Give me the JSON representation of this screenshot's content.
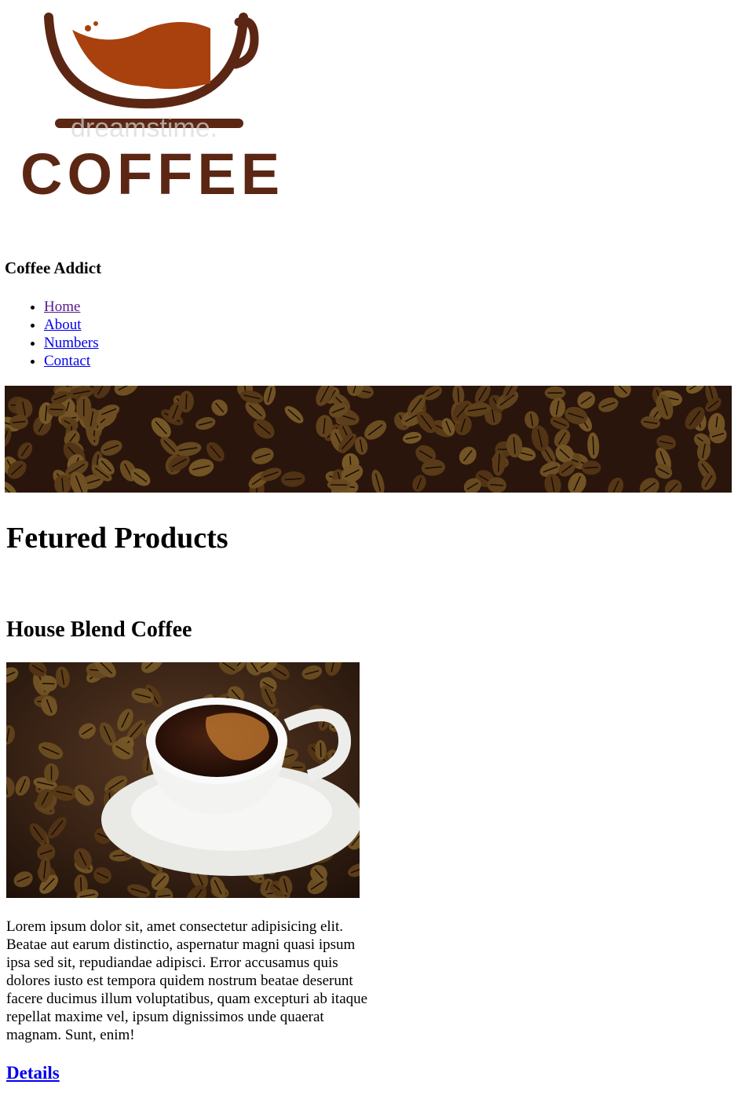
{
  "logo": {
    "wordmark": "COFFEE",
    "watermark": "dreamstime.",
    "colors": {
      "brown": "#5b2714",
      "orange": "#a8410e"
    }
  },
  "header": {
    "site_title": "Coffee Addict"
  },
  "nav": {
    "items": [
      {
        "label": "Home",
        "visited": true
      },
      {
        "label": "About",
        "visited": false
      },
      {
        "label": "Numbers",
        "visited": false
      },
      {
        "label": "Contact",
        "visited": false
      }
    ]
  },
  "banner": {
    "icon": "coffee-beans-banner"
  },
  "main": {
    "heading": "Fetured Products",
    "product": {
      "title": "House Blend Coffee",
      "image_icon": "coffee-cup-photo",
      "description": "Lorem ipsum dolor sit, amet consectetur adipisicing elit. Beatae aut earum distinctio, aspernatur magni quasi ipsum ipsa sed sit, repudiandae adipisci. Error accusamus quis dolores iusto est tempora quidem nostrum beatae deserunt facere ducimus illum voluptatibus, quam excepturi ab itaque repellat maxime vel, ipsum dignissimos unde quaerat magnam. Sunt, enim!",
      "details_label": "Details"
    }
  }
}
